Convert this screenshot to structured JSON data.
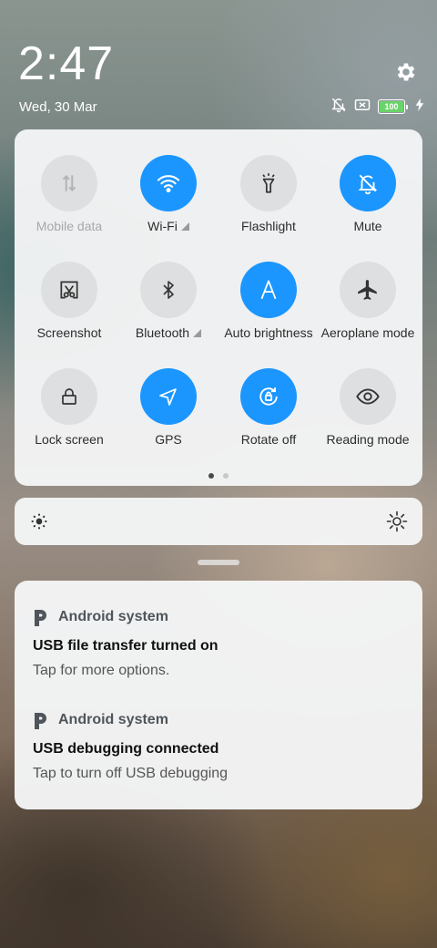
{
  "status": {
    "time": "2:47",
    "date": "Wed, 30 Mar",
    "battery": "100"
  },
  "quick_settings": {
    "tiles": [
      {
        "label": "Mobile data",
        "state": "disabled",
        "icon": "mobile-data-icon"
      },
      {
        "label": "Wi-Fi",
        "state": "on",
        "icon": "wifi-icon"
      },
      {
        "label": "Flashlight",
        "state": "off",
        "icon": "flashlight-icon"
      },
      {
        "label": "Mute",
        "state": "on",
        "icon": "mute-bell-icon"
      },
      {
        "label": "Screenshot",
        "state": "off",
        "icon": "screenshot-icon"
      },
      {
        "label": "Bluetooth",
        "state": "off",
        "icon": "bluetooth-icon"
      },
      {
        "label": "Auto brightness",
        "state": "on",
        "icon": "auto-brightness-icon"
      },
      {
        "label": "Aeroplane mode",
        "state": "off",
        "icon": "aeroplane-icon"
      },
      {
        "label": "Lock screen",
        "state": "off",
        "icon": "lock-icon"
      },
      {
        "label": "GPS",
        "state": "on",
        "icon": "gps-icon"
      },
      {
        "label": "Rotate off",
        "state": "on",
        "icon": "rotate-lock-icon"
      },
      {
        "label": "Reading mode",
        "state": "off",
        "icon": "eye-icon"
      }
    ],
    "page_indicator": {
      "pages": 2,
      "current": 1
    }
  },
  "colors": {
    "accent": "#1b96ff",
    "tile_off": "#dedfe0"
  },
  "notifications": [
    {
      "app": "Android system",
      "title": "USB file transfer turned on",
      "body": "Tap for more options."
    },
    {
      "app": "Android system",
      "title": "USB debugging connected",
      "body": "Tap to turn off USB debugging"
    }
  ]
}
